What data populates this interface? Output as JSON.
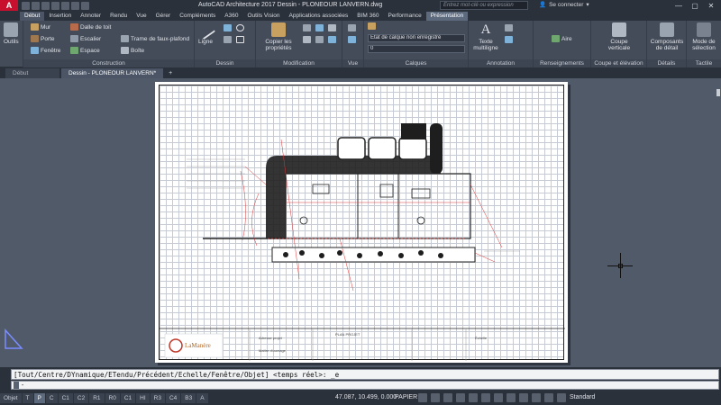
{
  "window": {
    "title": "AutoCAD Architecture 2017    Dessin - PLONEOUR LANVERN.dwg",
    "search_placeholder": "Entrez mot-clé ou expression",
    "signin": "Se connecter",
    "controls": [
      "—",
      "▢",
      "✕"
    ]
  },
  "ribbon_tabs": [
    {
      "label": "Début",
      "active": true
    },
    {
      "label": "Insertion"
    },
    {
      "label": "Annoter"
    },
    {
      "label": "Rendu"
    },
    {
      "label": "Vue"
    },
    {
      "label": "Gérer"
    },
    {
      "label": "Compléments"
    },
    {
      "label": "A360"
    },
    {
      "label": "Outils Vision"
    },
    {
      "label": "Applications associées"
    },
    {
      "label": "BIM 360"
    },
    {
      "label": "Performance"
    },
    {
      "label": "Présentation",
      "highlight": true
    }
  ],
  "ribbon": {
    "outils": "Outils",
    "construction": {
      "title": "Construction",
      "items": [
        "Mur",
        "Porte",
        "Fenêtre",
        "Dalle de toit",
        "Escalier",
        "Espace",
        "Trame de faux-plafond",
        "Boîte"
      ]
    },
    "dessin": {
      "title": "Dessin",
      "ligne": "Ligne"
    },
    "modification": {
      "title": "Modification",
      "copier": "Copier les propriétés"
    },
    "vue": {
      "title": "Vue"
    },
    "calques": {
      "title": "Calques",
      "state": "Etat de calque non enregistré",
      "layer": "0"
    },
    "annotation": {
      "title": "Annotation",
      "texte": "Texte multiligne"
    },
    "renseignements": {
      "title": "Renseignements",
      "aire": "Aire"
    },
    "coupe": {
      "title": "Coupe et élévation",
      "verticale": "Coupe verticale"
    },
    "details": {
      "title": "Détails",
      "composants": "Composants de détail"
    },
    "tactile": {
      "title": "Tactile",
      "mode": "Mode de sélection"
    }
  },
  "doc_tabs": [
    {
      "label": "Début",
      "active": false
    },
    {
      "label": "Dessin - PLONEOUR LANVERN*",
      "active": true
    },
    {
      "label": "+"
    }
  ],
  "title_block": {
    "logo": "LaManère",
    "cells": [
      "Adresse projet",
      "PLAN PROJET",
      "Maître d'ouvrage",
      "Échelle"
    ]
  },
  "command": {
    "history": "[Tout/Centre/DYnamique/ETendu/Précédent/Echelle/Fenêtre/Objet] <temps réel>: _e",
    "prompt": "-"
  },
  "status": {
    "tabs": [
      {
        "label": "Objet"
      },
      {
        "label": "T"
      },
      {
        "label": "P",
        "active": true
      },
      {
        "label": "C"
      },
      {
        "label": "C1"
      },
      {
        "label": "C2"
      },
      {
        "label": "R1"
      },
      {
        "label": "R0"
      },
      {
        "label": "C1"
      },
      {
        "label": "HI"
      },
      {
        "label": "R3"
      },
      {
        "label": "C4"
      },
      {
        "label": "B3"
      },
      {
        "label": "A"
      }
    ],
    "coords": "47.087, 10.499, 0.000",
    "mode": "PAPIER",
    "standard": "Standard"
  }
}
